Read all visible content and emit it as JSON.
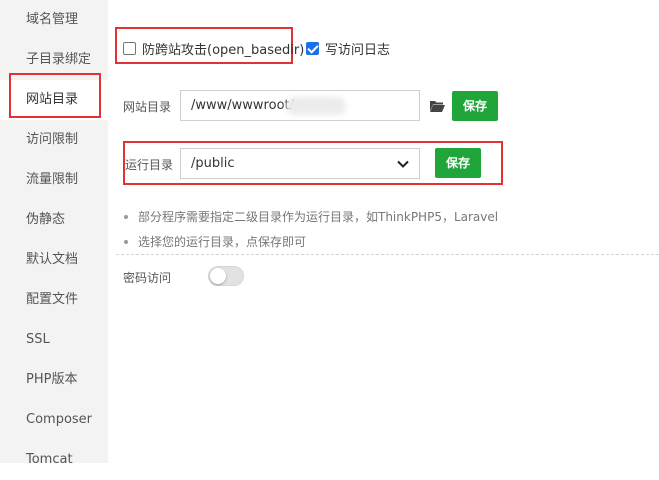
{
  "sidebar": {
    "items": [
      {
        "label": "域名管理"
      },
      {
        "label": "子目录绑定"
      },
      {
        "label": "网站目录"
      },
      {
        "label": "访问限制"
      },
      {
        "label": "流量限制"
      },
      {
        "label": "伪静态"
      },
      {
        "label": "默认文档"
      },
      {
        "label": "配置文件"
      },
      {
        "label": "SSL"
      },
      {
        "label": "PHP版本"
      },
      {
        "label": "Composer"
      },
      {
        "label": "Tomcat"
      }
    ],
    "active_index": 2
  },
  "options": {
    "anti_xss_label": "防跨站攻击(open_basedir)",
    "anti_xss_checked": false,
    "access_log_label": "写访问日志",
    "access_log_checked": true
  },
  "site_dir": {
    "label": "网站目录",
    "value": "/www/wwwroot/",
    "save_label": "保存"
  },
  "run_dir": {
    "label": "运行目录",
    "selected": "/public",
    "save_label": "保存"
  },
  "tips": [
    "部分程序需要指定二级目录作为运行目录，如ThinkPHP5，Laravel",
    "选择您的运行目录，点保存即可"
  ],
  "password_access": {
    "label": "密码访问",
    "enabled": false
  },
  "colors": {
    "accent_green": "#20a53a",
    "highlight_red": "#e03434",
    "checkbox_blue": "#1a73e8"
  }
}
